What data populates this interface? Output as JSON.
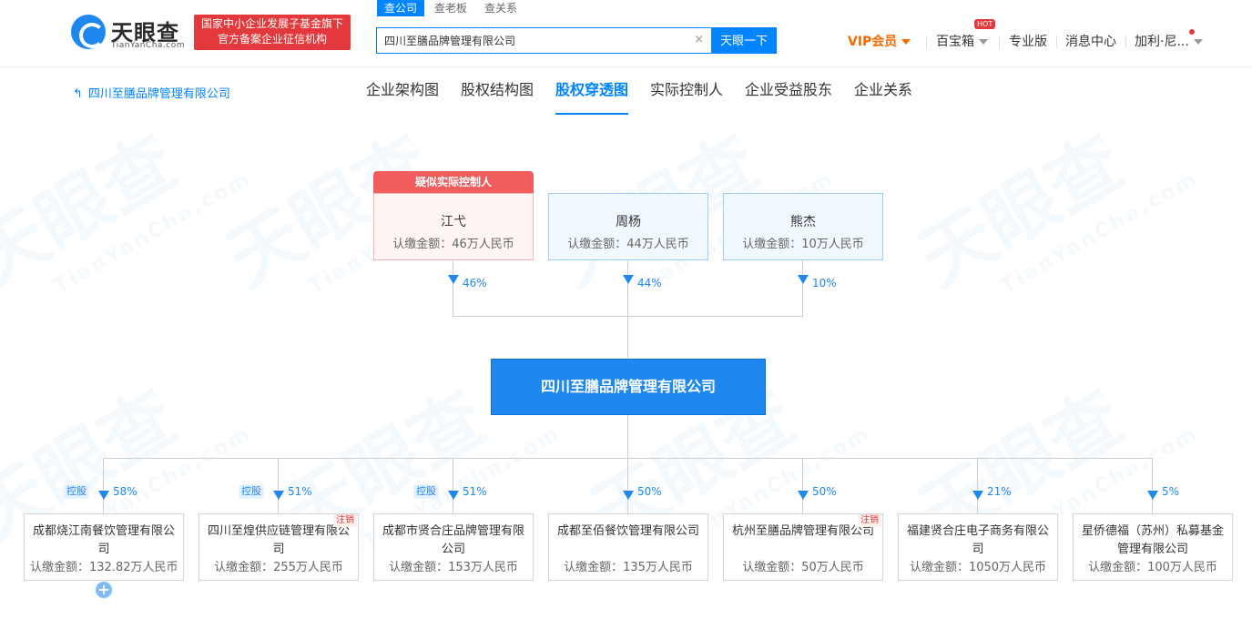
{
  "header": {
    "logo_title": "天眼查",
    "logo_sub": "TianYanCha.com",
    "gov_badge_line1": "国家中小企业发展子基金旗下",
    "gov_badge_line2": "官方备案企业征信机构",
    "search_tabs": [
      "查公司",
      "查老板",
      "查关系"
    ],
    "search_value": "四川至膳品牌管理有限公司",
    "search_button": "天眼一下",
    "clear_icon": "×",
    "nav": {
      "vip": "VIP会员",
      "toolbox": "百宝箱",
      "hot": "HOT",
      "pro": "专业版",
      "messages": "消息中心",
      "user": "加利·尼..."
    }
  },
  "subnav": {
    "back_label": "四川至膳品牌管理有限公司",
    "tabs": [
      "企业架构图",
      "股权结构图",
      "股权穿透图",
      "实际控制人",
      "企业受益股东",
      "企业关系"
    ],
    "active_tab": "股权穿透图"
  },
  "chart": {
    "suspect_label": "疑似实际控制人",
    "shareholders": [
      {
        "name": "江弋",
        "amount": "认缴金额：46万人民币",
        "pct": "46%"
      },
      {
        "name": "周杨",
        "amount": "认缴金额：44万人民币",
        "pct": "44%"
      },
      {
        "name": "熊杰",
        "amount": "认缴金额：10万人民币",
        "pct": "10%"
      }
    ],
    "center": "四川至膳品牌管理有限公司",
    "investments": [
      {
        "name": "成都烧江南餐饮管理有限公司",
        "amount": "认缴金额：132.82万人民币",
        "pct": "58%",
        "tag": "控股",
        "cancel": ""
      },
      {
        "name": "四川至煌供应链管理有限公司",
        "amount": "认缴金额：255万人民币",
        "pct": "51%",
        "tag": "控股",
        "cancel": "注销"
      },
      {
        "name": "成都市贤合庄品牌管理有限公司",
        "amount": "认缴金额：153万人民币",
        "pct": "51%",
        "tag": "控股",
        "cancel": ""
      },
      {
        "name": "成都至佰餐饮管理有限公司",
        "amount": "认缴金额：135万人民币",
        "pct": "50%",
        "tag": "",
        "cancel": ""
      },
      {
        "name": "杭州至膳品牌管理有限公司",
        "amount": "认缴金额：50万人民币",
        "pct": "50%",
        "tag": "",
        "cancel": "注销"
      },
      {
        "name": "福建贤合庄电子商务有限公司",
        "amount": "认缴金额：1050万人民币",
        "pct": "21%",
        "tag": "",
        "cancel": ""
      },
      {
        "name": "星侨德福（苏州）私募基金管理有限公司",
        "amount": "认缴金额：100万人民币",
        "pct": "5%",
        "tag": "",
        "cancel": ""
      }
    ],
    "expand_icon": "+"
  },
  "colors": {
    "brand_blue": "#1e87f0",
    "accent_red": "#e4393c",
    "vip_orange": "#f56a00"
  }
}
